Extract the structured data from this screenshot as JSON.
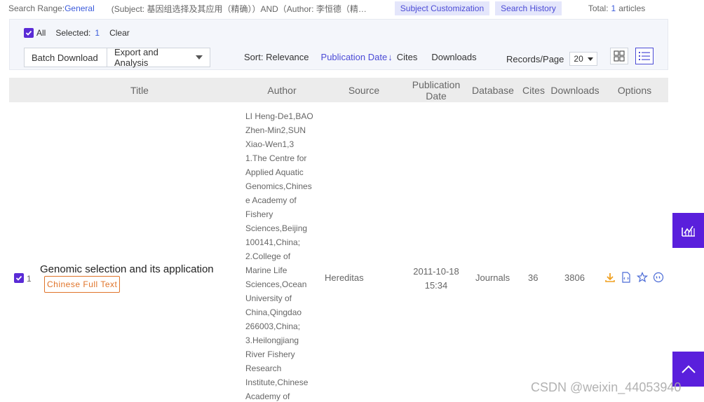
{
  "topbar": {
    "search_range_label": "Search Range:",
    "search_range_value": "General",
    "query": "(Subject: 基因组选择及其应用（精确））AND（Author: 李恒德（精…",
    "subject_customization": "Subject Customization",
    "search_history": "Search History",
    "total_label": "Total:",
    "total_count": "1",
    "total_unit": "articles"
  },
  "toolbar": {
    "all_label": "All",
    "selected_label": "Selected:",
    "selected_count": "1",
    "clear_label": "Clear",
    "batch_download": "Batch Download",
    "export_analysis": "Export and Analysis",
    "sort_label": "Sort:",
    "sort_options": {
      "relevance": "Relevance",
      "publication_date": "Publication Date",
      "cites": "Cites",
      "downloads": "Downloads"
    },
    "sort_arrow": "↓",
    "records_label": "Records/Page",
    "records_value": "20"
  },
  "table": {
    "headers": {
      "title": "Title",
      "author": "Author",
      "source": "Source",
      "pubdate_line1": "Publication",
      "pubdate_line2": "Date",
      "database": "Database",
      "cites": "Cites",
      "downloads": "Downloads",
      "options": "Options"
    },
    "rows": [
      {
        "index": "1",
        "title": "Genomic selection and its application",
        "fulltext_label": "Chinese Full Text",
        "author_lines": [
          "LI Heng-De1,BAO",
          "Zhen-Min2,SUN",
          "Xiao-Wen1,3",
          "1.The Centre for",
          "Applied Aquatic",
          "Genomics,Chines",
          "e Academy of",
          "Fishery",
          "Sciences,Beijing",
          "100141,China;",
          "2.College of",
          "Marine Life",
          "Sciences,Ocean",
          "University of",
          "China,Qingdao",
          "266003,China;",
          "3.Heilongjiang",
          "River Fishery",
          "Research",
          "Institute,Chinese",
          "Academy of"
        ],
        "source": "Hereditas",
        "pubdate_line1": "2011-10-18",
        "pubdate_line2": "15:34",
        "database": "Journals",
        "cites": "36",
        "downloads": "3806"
      }
    ]
  },
  "icons": {
    "download": "download-icon",
    "html_read": "html-read-icon",
    "favorite": "star-icon",
    "cite": "quote-icon",
    "analyze": "chart-icon",
    "to_top": "arrow-up-icon"
  },
  "colors": {
    "accent": "#5a1fdc",
    "link": "#3b5bdb",
    "fulltext": "#e0742a",
    "download_icon": "#f0a020"
  },
  "watermark": "CSDN @weixin_44053940"
}
